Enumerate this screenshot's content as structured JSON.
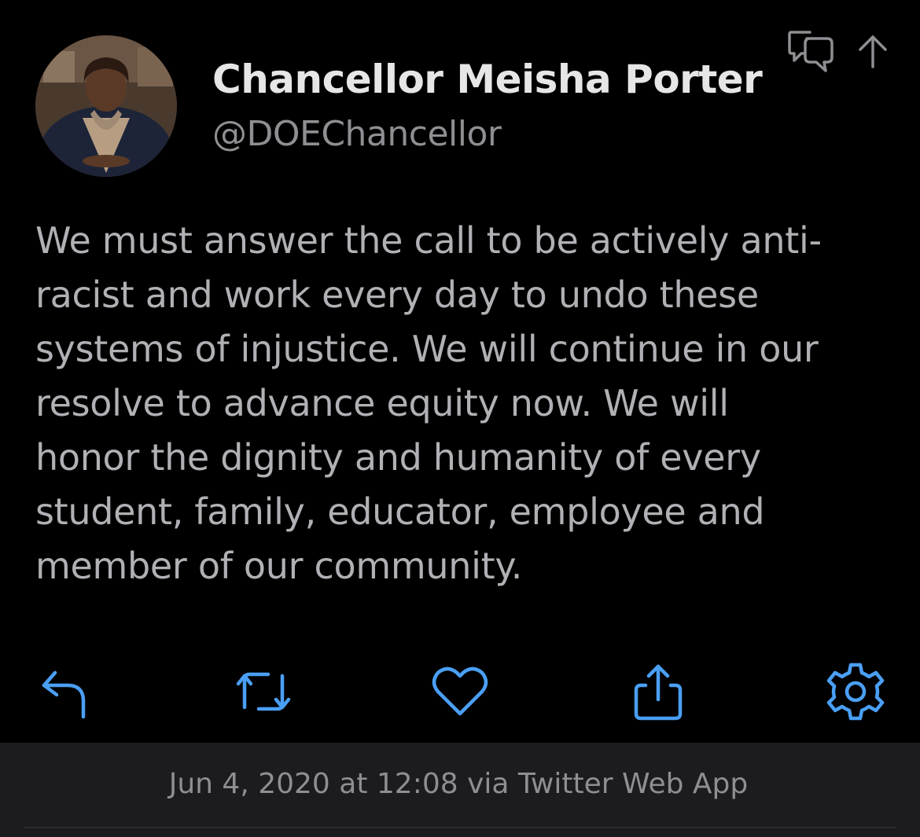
{
  "author": {
    "name": "Chancellor Meisha Porter",
    "handle": "@DOEChancellor",
    "avatar_icon": "profile-photo"
  },
  "header_icons": [
    "conversation-icon",
    "up-arrow-icon"
  ],
  "tweet": {
    "text": "We must answer the call to be actively anti-\nracist and work every day to undo these\nsystems of injustice. We will continue in our\nresolve to advance equity now. We will\nhonor the dignity and humanity of every\nstudent, family, educator, employee and\nmember of our community."
  },
  "actions": [
    {
      "name": "reply",
      "icon": "reply-icon"
    },
    {
      "name": "retweet",
      "icon": "retweet-icon"
    },
    {
      "name": "like",
      "icon": "heart-icon"
    },
    {
      "name": "share",
      "icon": "share-icon"
    },
    {
      "name": "settings",
      "icon": "gear-icon"
    }
  ],
  "footer": {
    "timestamp": "Jun 4, 2020 at 12:08 via Twitter Web App"
  },
  "colors": {
    "background": "#000000",
    "footer_background": "#1c1c1e",
    "accent": "#4a9ff5",
    "name": "#e6e6e6",
    "secondary": "#8e8e93"
  }
}
